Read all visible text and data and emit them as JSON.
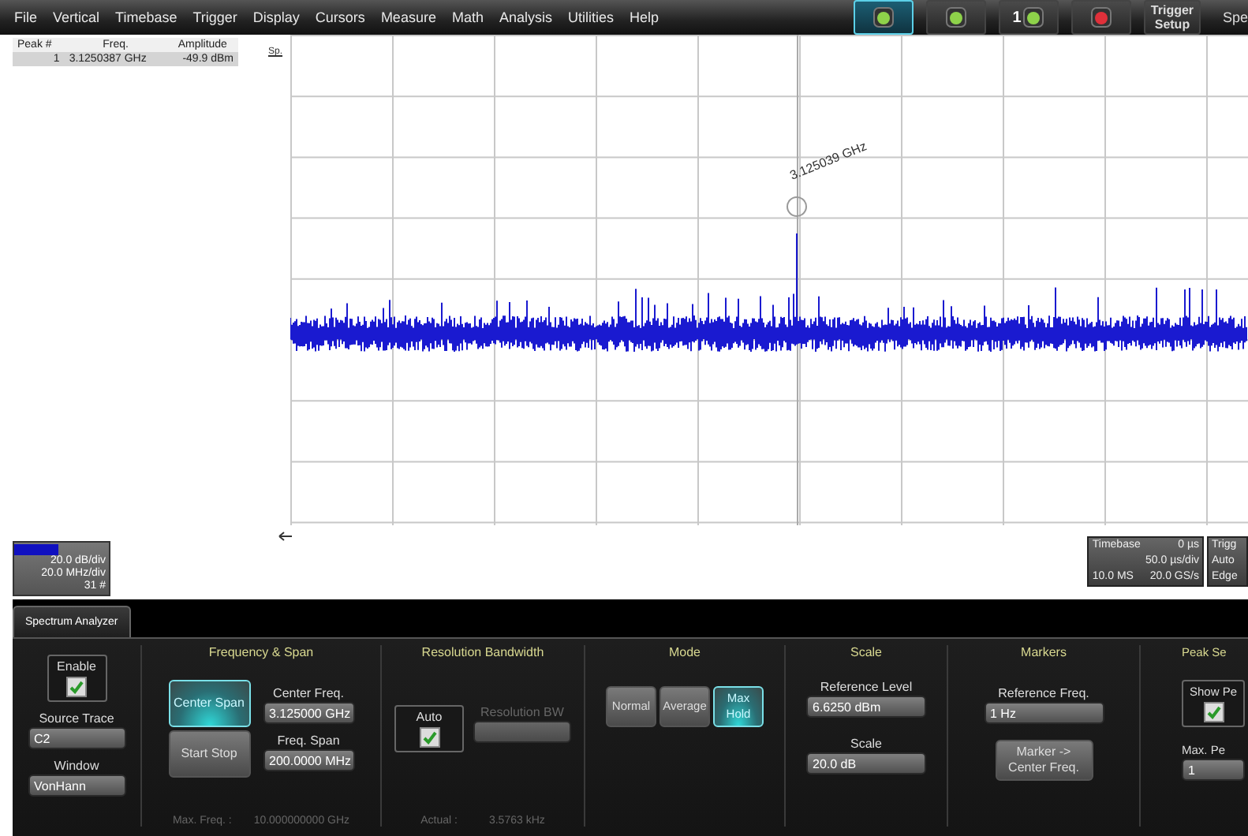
{
  "menu_bar": {
    "items": [
      "File",
      "Vertical",
      "Timebase",
      "Trigger",
      "Display",
      "Cursors",
      "Measure",
      "Math",
      "Analysis",
      "Utilities",
      "Help"
    ]
  },
  "toolbar": {
    "buttons": [
      {
        "kind": "icon",
        "selected": true,
        "color": "#8ed24a"
      },
      {
        "kind": "icon",
        "selected": false,
        "color": "#8ed24a"
      },
      {
        "kind": "icon",
        "selected": false,
        "color": "#8ed24a",
        "label": "1"
      },
      {
        "kind": "icon",
        "selected": false,
        "color": "#e0303a"
      },
      {
        "kind": "text",
        "selected": false,
        "label": "Trigger Setup"
      }
    ],
    "cut_label": "Spe"
  },
  "peak_table": {
    "columns": [
      "Peak #",
      "Freq.",
      "Amplitude"
    ],
    "rows": [
      [
        "1",
        "3.1250387 GHz",
        "-49.9 dBm"
      ]
    ]
  },
  "plot": {
    "axis_label": "Sp.",
    "marker_label": "3.125039 GHz"
  },
  "trace_descriptor": {
    "color": "#1010c0",
    "lines": [
      "20.0 dB/div",
      "20.0 MHz/div",
      "31 #"
    ]
  },
  "timebase": {
    "title": "Timebase",
    "delay": "0 µs",
    "per_div": "50.0 µs/div",
    "samples": "10.0 MS",
    "rate": "20.0 GS/s"
  },
  "trigger": {
    "title": "Trigg",
    "mode": "Auto",
    "type": "Edge"
  },
  "panel": {
    "tabs": [
      {
        "label": "Spectrum Analyzer",
        "selected": true
      }
    ],
    "general": {
      "enable": {
        "label": "Enable",
        "checked": true
      },
      "source": {
        "label": "Source Trace",
        "value": "C2"
      },
      "window": {
        "label": "Window",
        "value": "VonHann"
      }
    },
    "frequency_span": {
      "title": "Frequency & Span",
      "modes": [
        {
          "label": "Center Span",
          "selected": true
        },
        {
          "label": "Start Stop",
          "selected": false
        }
      ],
      "center": {
        "label": "Center Freq.",
        "value": "3.125000 GHz"
      },
      "span": {
        "label": "Freq. Span",
        "value": "200.0000 MHz"
      },
      "max_label": "Max. Freq. :",
      "max_value": "10.000000000 GHz"
    },
    "resolution": {
      "title": "Resolution Bandwidth",
      "auto": {
        "label": "Auto",
        "checked": true
      },
      "bw": {
        "label": "Resolution BW",
        "disabled": true
      },
      "actual_label": "Actual :",
      "actual_value": "3.5763 kHz"
    },
    "mode": {
      "title": "Mode",
      "options": [
        {
          "label": "Normal",
          "selected": false
        },
        {
          "label": "Average",
          "selected": false
        },
        {
          "label": "Max Hold",
          "selected": true
        }
      ]
    },
    "scale": {
      "title": "Scale",
      "reference": {
        "label": "Reference Level",
        "value": "6.6250 dBm"
      },
      "scale": {
        "label": "Scale",
        "value": "20.0 dB"
      }
    },
    "markers": {
      "title": "Markers",
      "reference": {
        "label": "Reference Freq.",
        "value": "1 Hz"
      },
      "button": "Marker -> Center Freq."
    },
    "peak_search": {
      "title": "Peak Se",
      "show": {
        "label": "Show Pe",
        "checked": true
      },
      "max": {
        "label": "Max. Pe",
        "value": "1"
      }
    }
  }
}
